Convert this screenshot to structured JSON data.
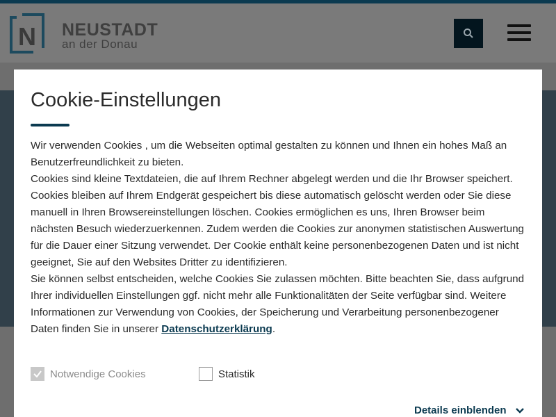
{
  "header": {
    "logo_letter": "N",
    "logo_line1": "NEUSTADT",
    "logo_line2": "an der Donau",
    "search_icon": "search-icon",
    "menu_icon": "hamburger-menu-icon"
  },
  "modal": {
    "title": "Cookie-Einstellungen",
    "paragraphs": [
      "Wir verwenden Cookies , um die Webseiten optimal gestalten zu können und Ihnen ein hohes Maß an Benutzerfreundlichkeit zu bieten.",
      "Cookies sind kleine Textdateien, die auf Ihrem Rechner abgelegt werden und die Ihr Browser speichert. Cookies bleiben auf Ihrem Endgerät gespeichert bis diese automatisch gelöscht werden oder Sie diese manuell in Ihren Browsereinstellungen löschen. Cookies ermöglichen es uns, Ihren Browser beim nächsten Besuch wiederzuerkennen. Zudem werden die Cookies zur anonymen statistischen Auswertung für die Dauer einer Sitzung verwendet. Der Cookie enthält keine personenbezogenen Daten und ist nicht geeignet, Sie auf den Websites Dritter zu identifizieren.",
      "Sie können selbst entscheiden, welche Cookies Sie zulassen möchten. Bitte beachten Sie, dass aufgrund Ihrer individuellen Einstellungen ggf. nicht mehr alle Funktionalitäten der Seite verfügbar sind. Weitere Informationen zur Verwendung von Cookies, der Speicherung und Verarbeitung personenbezogener Daten finden Sie in unserer"
    ],
    "privacy_link": "Datenschutzerklärung",
    "privacy_suffix": ".",
    "options": [
      {
        "label": "Notwendige Cookies",
        "checked": true,
        "disabled": true
      },
      {
        "label": "Statistik",
        "checked": false,
        "disabled": false
      }
    ],
    "details_label": "Details einblenden"
  },
  "colors": {
    "accent": "#0b3a50",
    "overlay": "#6e6e6e",
    "text": "#2b2b2b"
  }
}
